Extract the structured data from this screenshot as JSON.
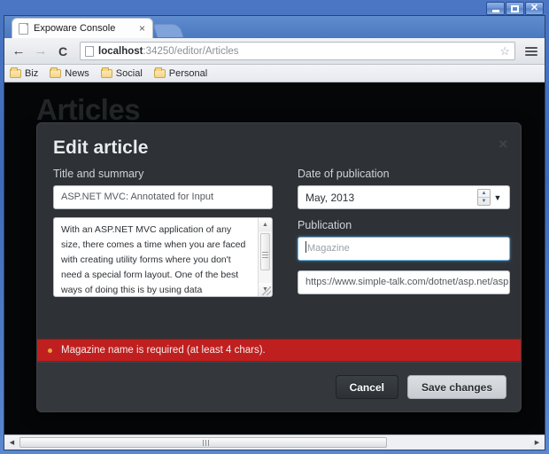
{
  "window": {
    "minimize_label": "–",
    "maximize_label": "□",
    "close_label": "✕"
  },
  "browser": {
    "tab": {
      "title": "Expoware Console",
      "close_label": "×"
    },
    "nav": {
      "back": "←",
      "forward": "→",
      "reload": "C"
    },
    "omnibox": {
      "url_host": "localhost",
      "url_rest": ":34250/editor/Articles",
      "star": "☆"
    },
    "bookmarks": [
      {
        "label": "Biz"
      },
      {
        "label": "News"
      },
      {
        "label": "Social"
      },
      {
        "label": "Personal"
      }
    ]
  },
  "page": {
    "heading": "Articles"
  },
  "modal": {
    "title": "Edit article",
    "close_label": "✕",
    "left": {
      "label": "Title and summary",
      "title_value": "ASP.NET MVC: Annotated for Input",
      "summary_value": "With an ASP.NET MVC application of any size, there comes a time when you are faced with creating utility forms where you don't need a special form layout. One of the best ways of doing this is by using data annotations. Despite a"
    },
    "right": {
      "date_label": "Date of publication",
      "date_value": "May, 2013",
      "spinner_up": "▲",
      "spinner_down": "▼",
      "dropdown_arrow": "▼",
      "publication_label": "Publication",
      "publication_placeholder": "Magazine",
      "url_value": "https://www.simple-talk.com/dotnet/asp.net/asp.net-"
    },
    "error": {
      "message": "Magazine name is required (at least 4 chars)."
    },
    "footer": {
      "cancel_label": "Cancel",
      "save_label": "Save changes"
    }
  },
  "scrollbar": {
    "left_arrow": "◀",
    "right_arrow": "▶"
  },
  "colors": {
    "error_red": "#bf201f",
    "modal_bg": "#2e3236",
    "focus_blue": "#6fb5e8",
    "chrome_blue": "#4a76c4"
  }
}
